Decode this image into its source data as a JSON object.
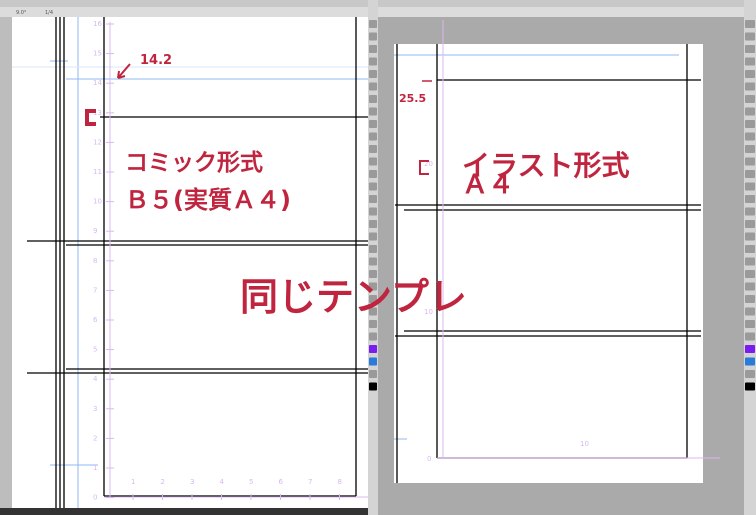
{
  "left_window": {
    "toolbar_rotation": "9.0°",
    "toolbar_zoom": "1/4",
    "ruler_vertical_labels": [
      "16",
      "15",
      "14",
      "13",
      "12",
      "11",
      "10",
      "9",
      "8",
      "7",
      "6",
      "5",
      "4",
      "3",
      "2",
      "1",
      "0"
    ],
    "ruler_horizontal_labels": [
      "1",
      "2",
      "3",
      "4",
      "5",
      "6",
      "7",
      "8"
    ]
  },
  "right_window": {
    "ruler_labels": [
      "20",
      "10",
      "0",
      "10"
    ]
  },
  "annotations": {
    "left_measure": "14.2",
    "left_format": "コミック形式",
    "left_size": "Ｂ５(実質Ａ４)",
    "center": "同じテンプレ",
    "right_measure": "25.5",
    "right_format": "イラスト形式",
    "right_size": "Ａ４"
  },
  "colors": {
    "annotation": "#c0253f",
    "guide": "#8fb8f0",
    "ruler": "#d8b8f0",
    "pasteboard": "#aaaaaa"
  }
}
